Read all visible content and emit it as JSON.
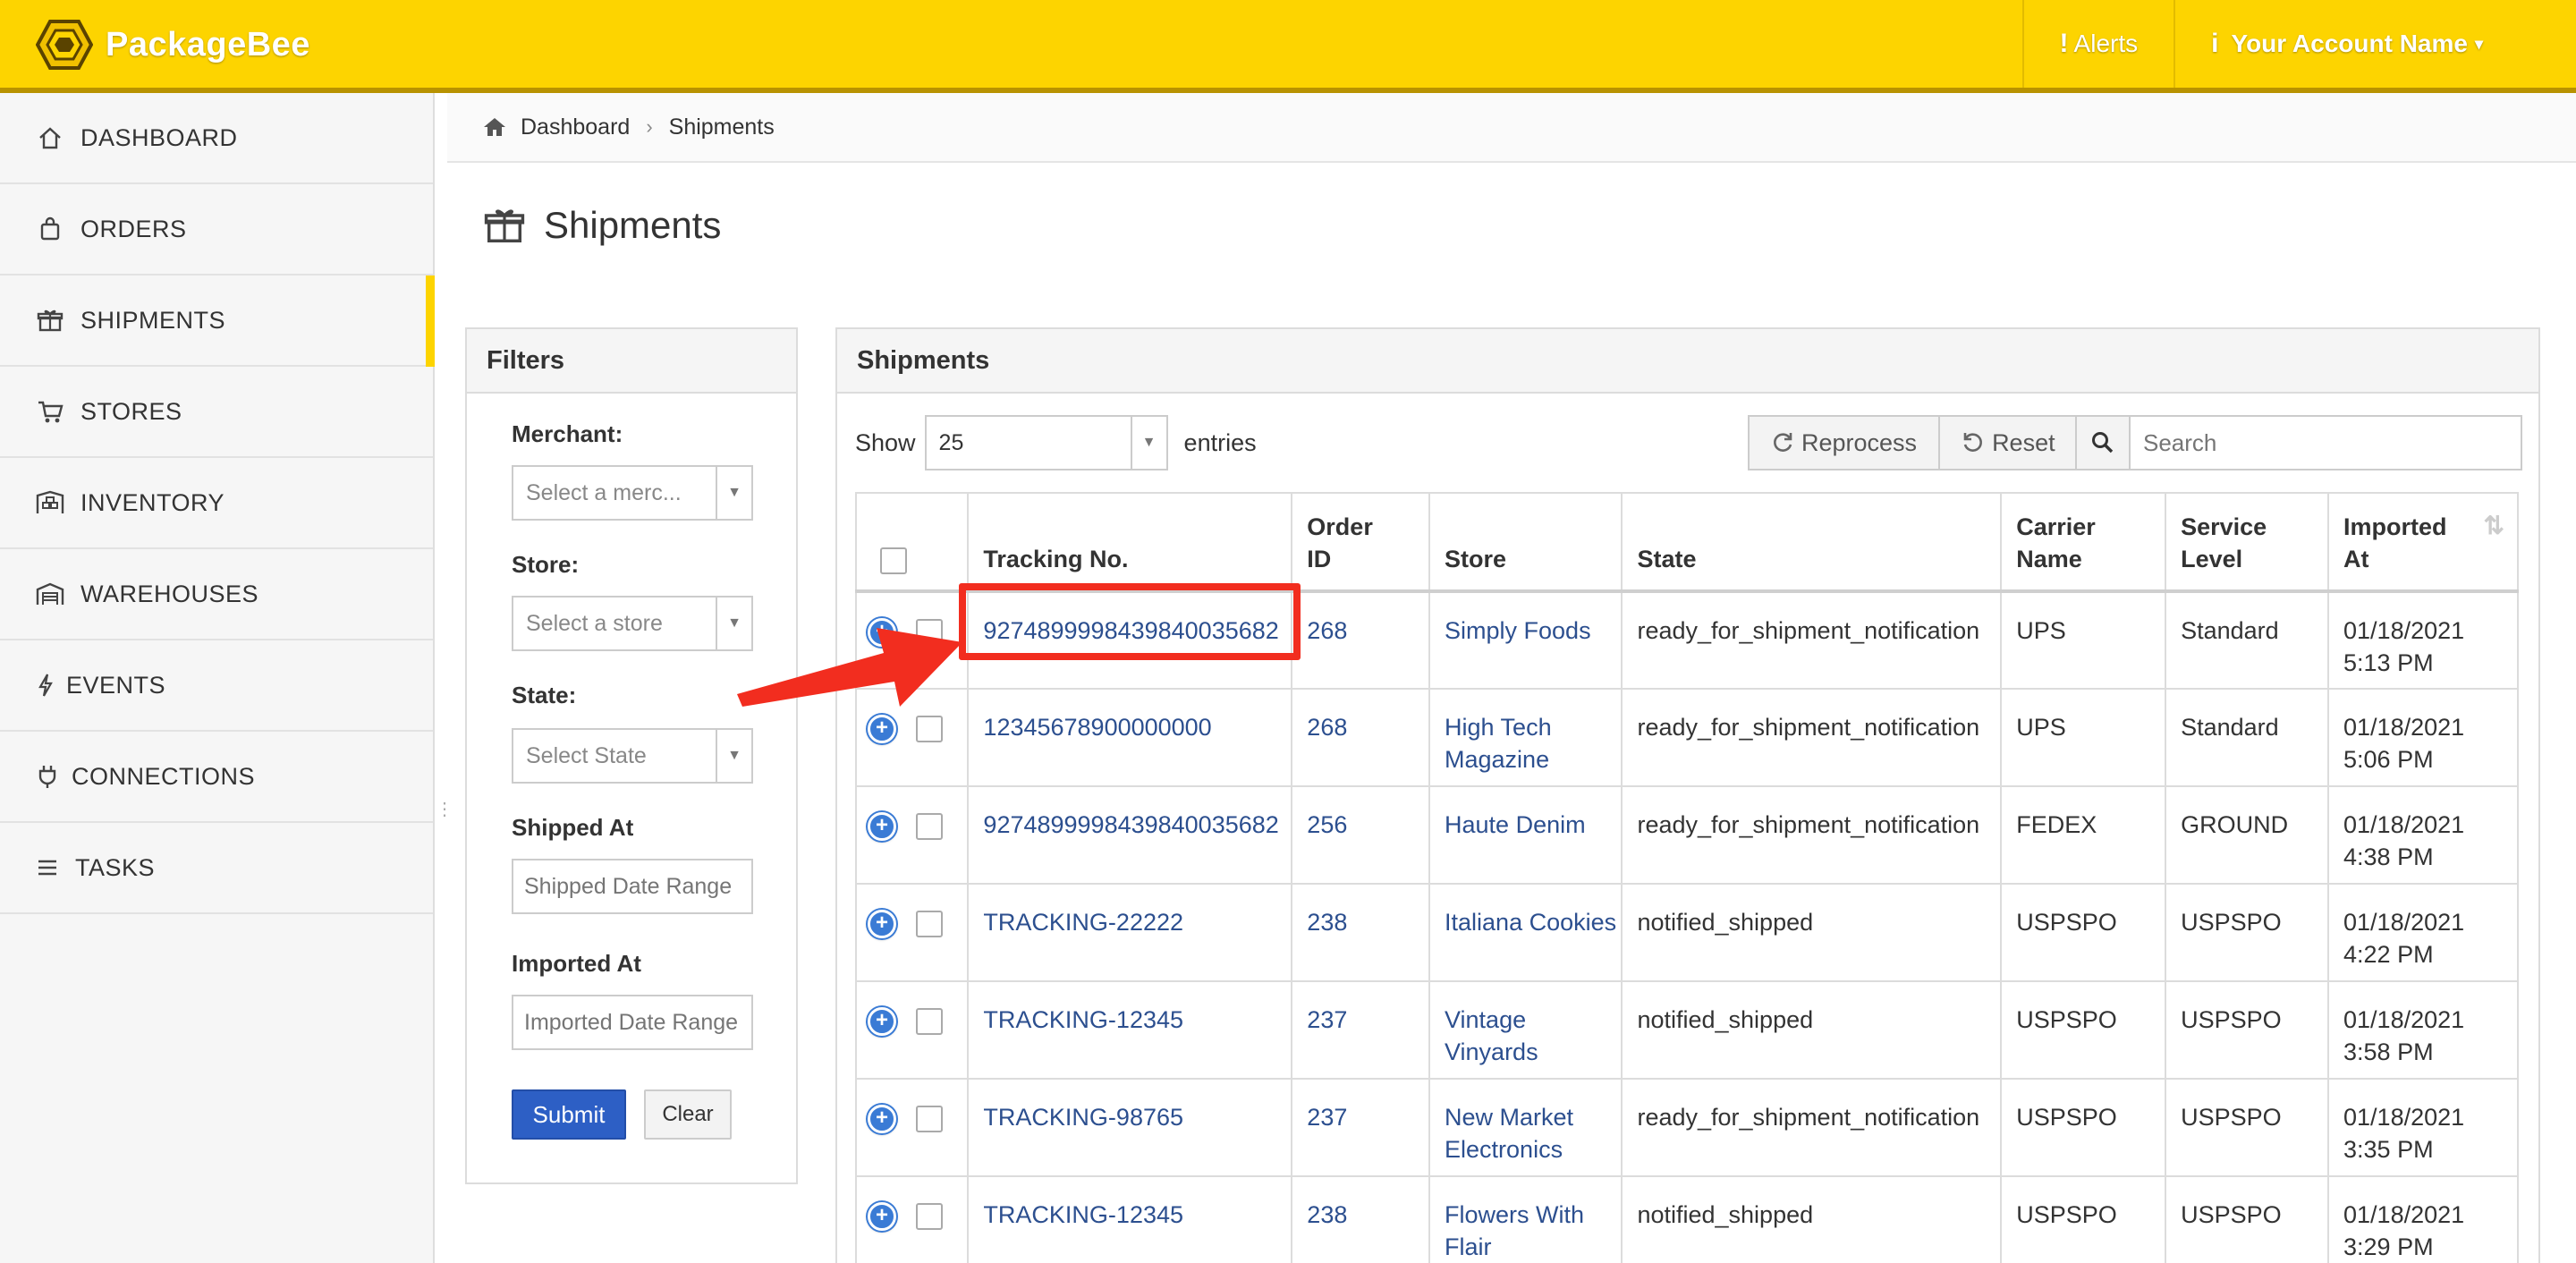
{
  "app": {
    "name": "PackageBee"
  },
  "topnav": {
    "alerts": "Alerts",
    "account": "Your Account Name"
  },
  "sidebar": {
    "items": [
      {
        "label": "DASHBOARD",
        "icon": "home-icon"
      },
      {
        "label": "ORDERS",
        "icon": "bag-icon"
      },
      {
        "label": "SHIPMENTS",
        "icon": "gift-icon",
        "active": true
      },
      {
        "label": "STORES",
        "icon": "cart-icon"
      },
      {
        "label": "INVENTORY",
        "icon": "inventory-icon"
      },
      {
        "label": "WAREHOUSES",
        "icon": "warehouse-icon"
      },
      {
        "label": "EVENTS",
        "icon": "bolt-icon"
      },
      {
        "label": "CONNECTIONS",
        "icon": "plug-icon"
      },
      {
        "label": "TASKS",
        "icon": "list-icon"
      }
    ]
  },
  "breadcrumb": {
    "home": "Dashboard",
    "current": "Shipments"
  },
  "page": {
    "title": "Shipments"
  },
  "filters": {
    "title": "Filters",
    "merchant_label": "Merchant:",
    "merchant_placeholder": "Select a merc...",
    "store_label": "Store:",
    "store_placeholder": "Select a store",
    "state_label": "State:",
    "state_placeholder": "Select State",
    "shipped_label": "Shipped At",
    "shipped_placeholder": "Shipped Date Range",
    "imported_label": "Imported At",
    "imported_placeholder": "Imported Date Range",
    "submit": "Submit",
    "clear": "Clear"
  },
  "shipments": {
    "title": "Shipments",
    "show_label": "Show",
    "page_length": "25",
    "entries_label": "entries",
    "reprocess": "Reprocess",
    "reset": "Reset",
    "search_placeholder": "Search",
    "columns": [
      "Tracking No.",
      "Order ID",
      "Store",
      "State",
      "Carrier Name",
      "Service Level",
      "Imported At"
    ],
    "rows": [
      {
        "tracking": "927489999843984003568​2",
        "order_id": "268",
        "store": "Simply Foods",
        "state": "ready_for_shipment_notification",
        "carrier": "UPS",
        "service": "Standard",
        "imported_date": "01/18/2021",
        "imported_time": "5:13 PM"
      },
      {
        "tracking": "12345678900000000",
        "order_id": "268",
        "store": "High Tech Magazine",
        "state": "ready_for_shipment_notification",
        "carrier": "UPS",
        "service": "Standard",
        "imported_date": "01/18/2021",
        "imported_time": "5:06 PM"
      },
      {
        "tracking": "9274899998439840035682",
        "order_id": "256",
        "store": "Haute Denim",
        "state": "ready_for_shipment_notification",
        "carrier": "FEDEX",
        "service": "GROUND",
        "imported_date": "01/18/2021",
        "imported_time": "4:38 PM"
      },
      {
        "tracking": "TRACKING-22222",
        "order_id": "238",
        "store": "Italiana Cookies",
        "state": "notified_shipped",
        "carrier": "USPSPO",
        "service": "USPSPO",
        "imported_date": "01/18/2021",
        "imported_time": "4:22 PM"
      },
      {
        "tracking": "TRACKING-12345",
        "order_id": "237",
        "store": "Vintage Vinyards",
        "state": "notified_shipped",
        "carrier": "USPSPO",
        "service": "USPSPO",
        "imported_date": "01/18/2021",
        "imported_time": "3:58 PM"
      },
      {
        "tracking": "TRACKING-98765",
        "order_id": "237",
        "store": "New Market Electronics",
        "state": "ready_for_shipment_notification",
        "carrier": "USPSPO",
        "service": "USPSPO",
        "imported_date": "01/18/2021",
        "imported_time": "3:35 PM"
      },
      {
        "tracking": "TRACKING-12345",
        "order_id": "238",
        "store": "Flowers With Flair",
        "state": "notified_shipped",
        "carrier": "USPSPO",
        "service": "USPSPO",
        "imported_date": "01/18/2021",
        "imported_time": "3:29 PM"
      }
    ]
  },
  "colors": {
    "brand": "#fdd400",
    "link": "#2c4f8f",
    "primary_button": "#2d5fc5",
    "highlight": "#f22d1f"
  }
}
